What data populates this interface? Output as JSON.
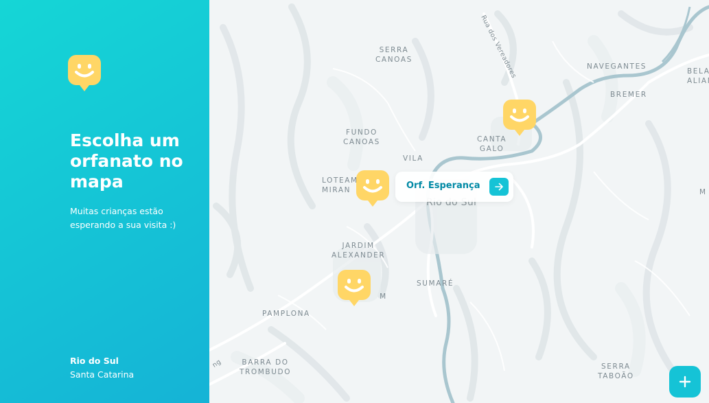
{
  "sidebar": {
    "logo_icon": "happy-marker-icon",
    "title": "Escolha um orfanato no mapa",
    "subtitle": "Muitas crianças estão esperando a sua visita :)",
    "location": {
      "city": "Rio do Sul",
      "state": "Santa Catarina"
    }
  },
  "map": {
    "labels": {
      "serra_canoas": "SERRA\nCANOAS",
      "fundo_canoas": "FUNDO\nCANOAS",
      "navegantes": "NAVEGANTES",
      "bremer": "BREMER",
      "bela_aliana": "BELA\nALIAN",
      "canta_galo": "CANTA\nGALO",
      "vila": "VILA",
      "loteamento": "LOTEAM\nMIRAN",
      "rio_do_sul": "Rio do Sul",
      "jardim_alexander": "JARDIM\nALEXANDER",
      "sumare": "SUMARÉ",
      "barragem": "BA       M",
      "pamplona": "PAMPLONA",
      "barra_do_trombudo": "BARRA DO\nTROMBUDO",
      "serra_taboao": "SERRA\nTABOÃO",
      "street_vereadores": "Rua dos Vereadores",
      "m_edge": "M",
      "ng_edge": "ng"
    },
    "popup": {
      "name": "Orf. Esperança",
      "action_icon": "arrow-right-icon"
    },
    "markers": [
      "happy-marker-icon",
      "happy-marker-icon",
      "happy-marker-icon"
    ],
    "add_button_icon": "plus-icon"
  },
  "colors": {
    "accent": "#15c3d6",
    "marker": "#ffd666",
    "river": "#a9c6cf",
    "primary_text": "#0089a5"
  }
}
